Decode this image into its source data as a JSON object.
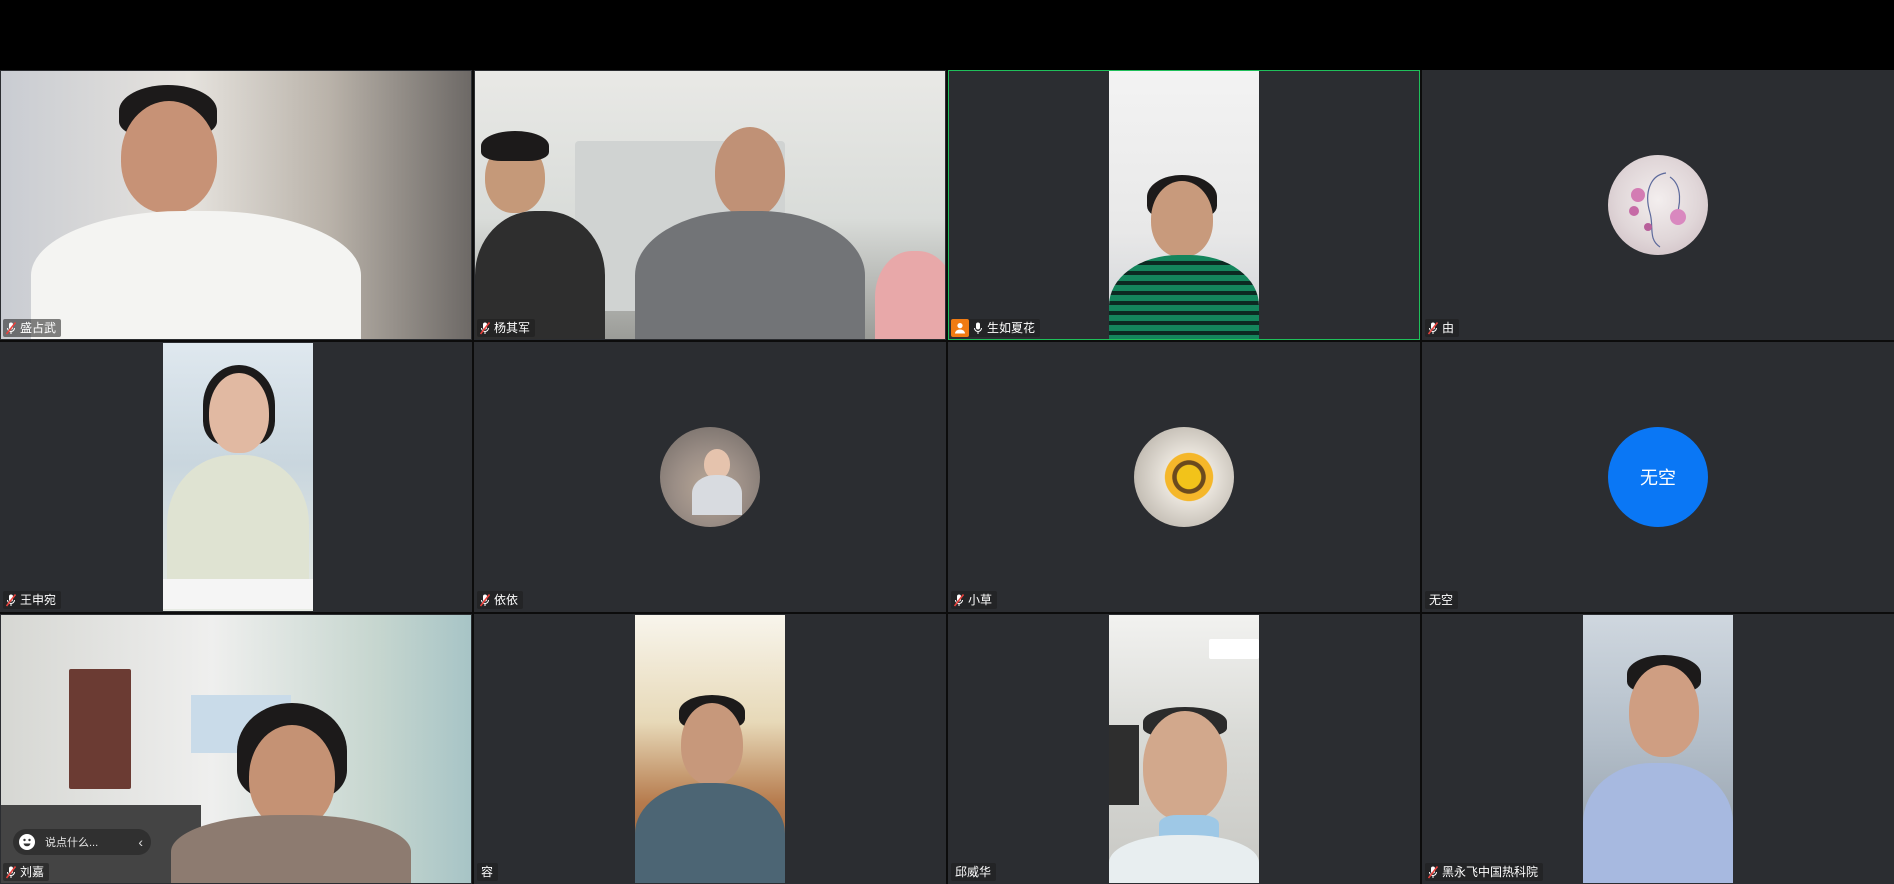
{
  "participants": [
    {
      "name": "盛占武",
      "mic": "muted",
      "view": "video"
    },
    {
      "name": "杨其军",
      "mic": "muted",
      "view": "video"
    },
    {
      "name": "生如夏花",
      "mic": "on",
      "view": "video",
      "host": true,
      "speaking": true
    },
    {
      "name": "由",
      "mic": "muted",
      "view": "avatar"
    },
    {
      "name": "王申宛",
      "mic": "muted",
      "view": "video"
    },
    {
      "name": "依依",
      "mic": "muted",
      "view": "avatar"
    },
    {
      "name": "小草",
      "mic": "muted",
      "view": "avatar"
    },
    {
      "name": "无空",
      "mic": "none",
      "view": "avatar",
      "avatar_text": "无空"
    },
    {
      "name": "刘嘉",
      "mic": "muted",
      "view": "video"
    },
    {
      "name": "容",
      "mic": "none",
      "view": "video"
    },
    {
      "name": "邱威华",
      "mic": "none",
      "view": "video"
    },
    {
      "name": "黑永飞中国热科院",
      "mic": "muted",
      "view": "video"
    }
  ],
  "chat": {
    "placeholder": "说点什么...",
    "emoji_icon": "emoji-smile-icon",
    "collapse_icon": "chevron-left-icon"
  },
  "colors": {
    "tile_bg": "#2b2d31",
    "active_speaker_border": "#1fbf5a",
    "host_badge": "#f07b13",
    "muted_mic": "#e8413c",
    "text_avatar_bg": "#0a77f5"
  }
}
